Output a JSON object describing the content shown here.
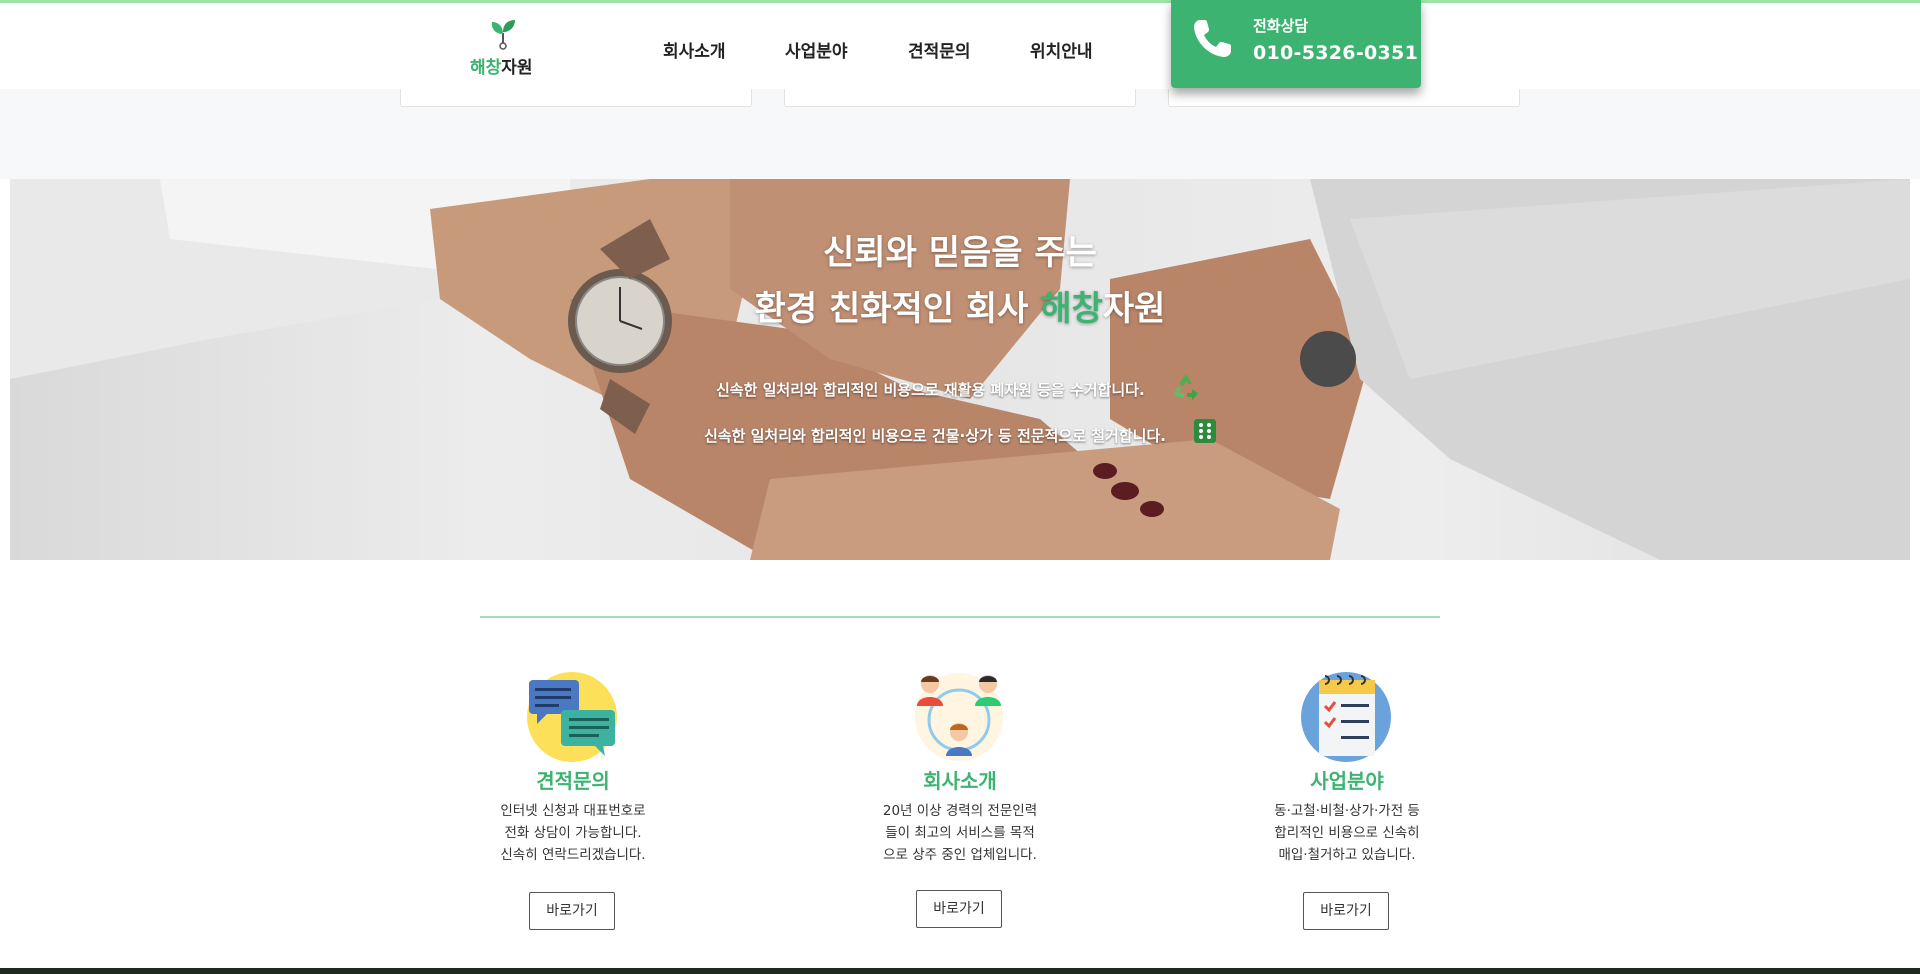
{
  "brand": {
    "logo_green": "해창",
    "logo_dark": "자원",
    "accent_color": "#3cb371"
  },
  "nav": {
    "items": [
      {
        "label": "회사소개"
      },
      {
        "label": "사업분야"
      },
      {
        "label": "견적문의"
      },
      {
        "label": "위치안내"
      }
    ]
  },
  "phone": {
    "label": "전화상담",
    "number": "010-5326-0351"
  },
  "hero": {
    "line1": "신뢰와 믿음을 주는",
    "line2_prefix": "환경 친화적인 회사 ",
    "line2_green": "해창",
    "line2_suffix": "자원",
    "sub1": "신속한 일처리와 합리적인 비용으로 재활용 폐자원 등을 수거합니다.",
    "sub2": "신속한 일처리와 합리적인 비용으로 건물·상가 등 전문적으로 철거합니다.",
    "icon1": "recycle-icon",
    "icon2": "dice-icon"
  },
  "features": [
    {
      "icon": "chat-bubbles-icon",
      "title": "견적문의",
      "desc": [
        "인터넷 신청과 대표번호로",
        "전화 상담이 가능합니다.",
        "신속히 연락드리겠습니다."
      ],
      "button": "바로가기"
    },
    {
      "icon": "team-icon",
      "title": "회사소개",
      "desc": [
        "20년 이상 경력의 전문인력",
        "들이 최고의 서비스를 목적",
        "으로 상주 중인 업체입니다."
      ],
      "button": "바로가기"
    },
    {
      "icon": "checklist-icon",
      "title": "사업분야",
      "desc": [
        "동·고철·비철·상가·가전 등",
        "합리적인 비용으로 신속히",
        "매입·철거하고 있습니다."
      ],
      "button": "바로가기"
    }
  ]
}
